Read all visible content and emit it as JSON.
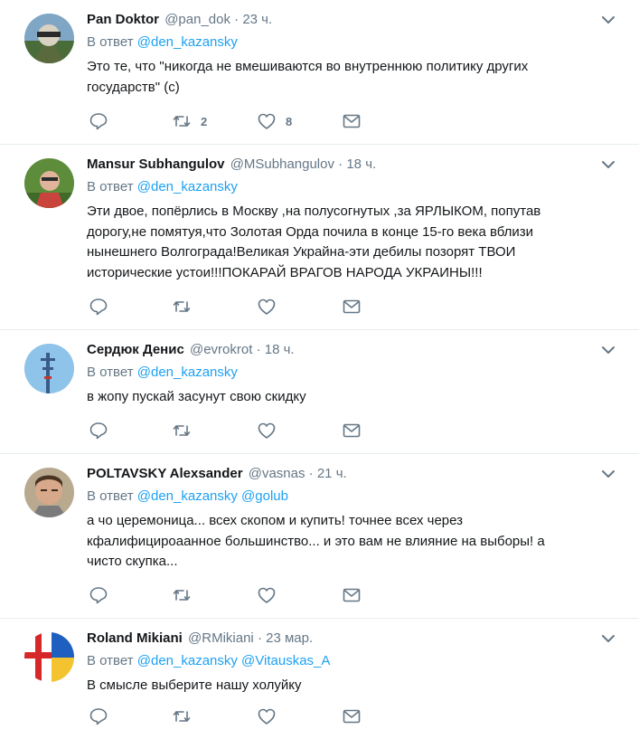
{
  "reply_prefix": "В ответ",
  "icons": {
    "reply": "reply-icon",
    "retweet": "retweet-icon",
    "like": "heart-icon",
    "dm": "envelope-icon",
    "more": "chevron-down-icon"
  },
  "colors": {
    "link": "#1da1f2",
    "secondary": "#657786",
    "text": "#14171a",
    "divider": "#e6ecf0"
  },
  "tweets": [
    {
      "fullname": "Pan Doktor",
      "username": "@pan_dok",
      "dot": "·",
      "time": "23 ч.",
      "mentions": [
        "@den_kazansky"
      ],
      "text": "Это те, что \"никогда не вмешиваются во внутреннюю политику других\nгосударств\" (с)",
      "retweets": "2",
      "likes": "8"
    },
    {
      "fullname": "Mansur Subhangulov",
      "username": "@MSubhangulov",
      "dot": "·",
      "time": "18 ч.",
      "mentions": [
        "@den_kazansky"
      ],
      "text": "Эти двое, попёрлись в Москву ,на полусогнутых ,за ЯРЛЫКОМ, попутав\nдорогу,не помятуя,что Золотая Орда почила в конце 15-го века вблизи\nнынешнего Волгограда!Великая Украйна-эти дебилы позорят ТВОИ\nисторические устои!!!ПОКАРАЙ ВРАГОВ НАРОДА УКРАИНЫ!!!",
      "retweets": "",
      "likes": ""
    },
    {
      "fullname": "Сердюк Денис",
      "username": "@evrokrot",
      "dot": "·",
      "time": "18 ч.",
      "mentions": [
        "@den_kazansky"
      ],
      "text": "в жопу пускай засунут свою скидку",
      "retweets": "",
      "likes": ""
    },
    {
      "fullname": "POLTAVSKY Alexsander",
      "username": "@vasnas",
      "dot": "·",
      "time": "21 ч.",
      "mentions": [
        "@den_kazansky",
        "@golub"
      ],
      "text": "а чо церемоница... всех скопом и купить! точнее всех через\nкфалифицироаанное большинство... и это вам не влияние на выборы! а\nчисто скупка...",
      "retweets": "",
      "likes": ""
    },
    {
      "fullname": "Roland Mikiani",
      "username": "@RMikiani",
      "dot": "·",
      "time": "23 мар.",
      "mentions": [
        "@den_kazansky",
        "@Vitauskas_A"
      ],
      "text": "В смысле выберите нашу холуйку",
      "retweets": "",
      "likes": ""
    }
  ]
}
